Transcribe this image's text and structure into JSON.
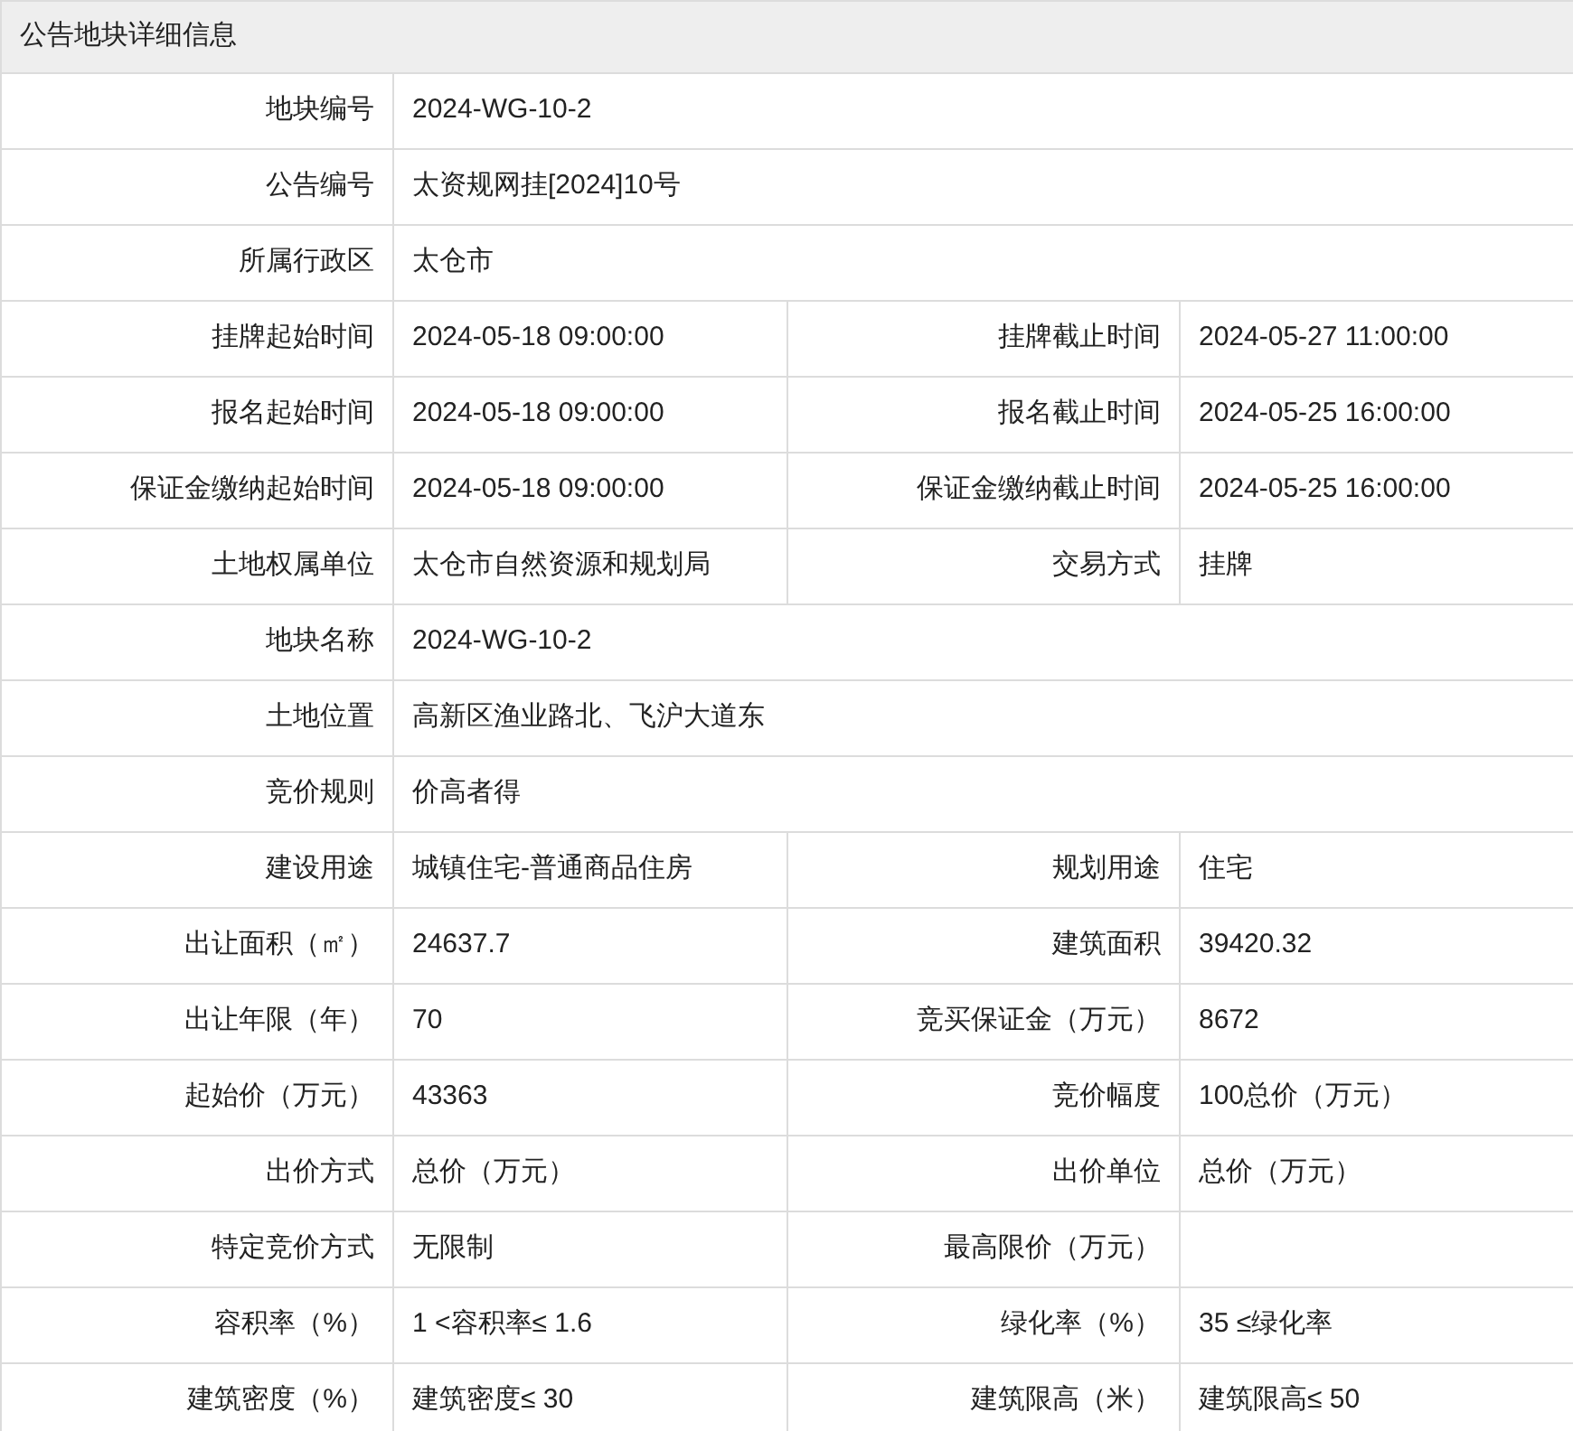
{
  "title": "公告地块详细信息",
  "rows": [
    [
      {
        "label": "地块编号",
        "value": "2024-WG-10-2"
      }
    ],
    [
      {
        "label": "公告编号",
        "value": "太资规网挂[2024]10号"
      }
    ],
    [
      {
        "label": "所属行政区",
        "value": "太仓市"
      }
    ],
    [
      {
        "label": "挂牌起始时间",
        "value": "2024-05-18 09:00:00"
      },
      {
        "label": "挂牌截止时间",
        "value": "2024-05-27 11:00:00"
      }
    ],
    [
      {
        "label": "报名起始时间",
        "value": "2024-05-18 09:00:00"
      },
      {
        "label": "报名截止时间",
        "value": "2024-05-25 16:00:00"
      }
    ],
    [
      {
        "label": "保证金缴纳起始时间",
        "value": "2024-05-18 09:00:00"
      },
      {
        "label": "保证金缴纳截止时间",
        "value": "2024-05-25 16:00:00"
      }
    ],
    [
      {
        "label": "土地权属单位",
        "value": "太仓市自然资源和规划局"
      },
      {
        "label": "交易方式",
        "value": "挂牌"
      }
    ],
    [
      {
        "label": "地块名称",
        "value": "2024-WG-10-2"
      }
    ],
    [
      {
        "label": "土地位置",
        "value": "高新区渔业路北、飞沪大道东"
      }
    ],
    [
      {
        "label": "竞价规则",
        "value": "价高者得"
      }
    ],
    [
      {
        "label": "建设用途",
        "value": "城镇住宅-普通商品住房"
      },
      {
        "label": "规划用途",
        "value": "住宅"
      }
    ],
    [
      {
        "label": "出让面积（㎡）",
        "value": "24637.7"
      },
      {
        "label": "建筑面积",
        "value": "39420.32"
      }
    ],
    [
      {
        "label": "出让年限（年）",
        "value": "70"
      },
      {
        "label": "竞买保证金（万元）",
        "value": "8672"
      }
    ],
    [
      {
        "label": "起始价（万元）",
        "value": "43363"
      },
      {
        "label": "竞价幅度",
        "value": "100总价（万元）"
      }
    ],
    [
      {
        "label": "出价方式",
        "value": "总价（万元）"
      },
      {
        "label": "出价单位",
        "value": "总价（万元）"
      }
    ],
    [
      {
        "label": "特定竞价方式",
        "value": "无限制"
      },
      {
        "label": "最高限价（万元）"
      }
    ],
    [
      {
        "label": "容积率（%）",
        "value": "1 <容积率≤ 1.6"
      },
      {
        "label": "绿化率（%）",
        "value": "35 ≤绿化率"
      }
    ],
    [
      {
        "label": "建筑密度（%）",
        "value": "建筑密度≤ 30"
      },
      {
        "label": "建筑限高（米）",
        "value": "建筑限高≤ 50"
      }
    ]
  ]
}
